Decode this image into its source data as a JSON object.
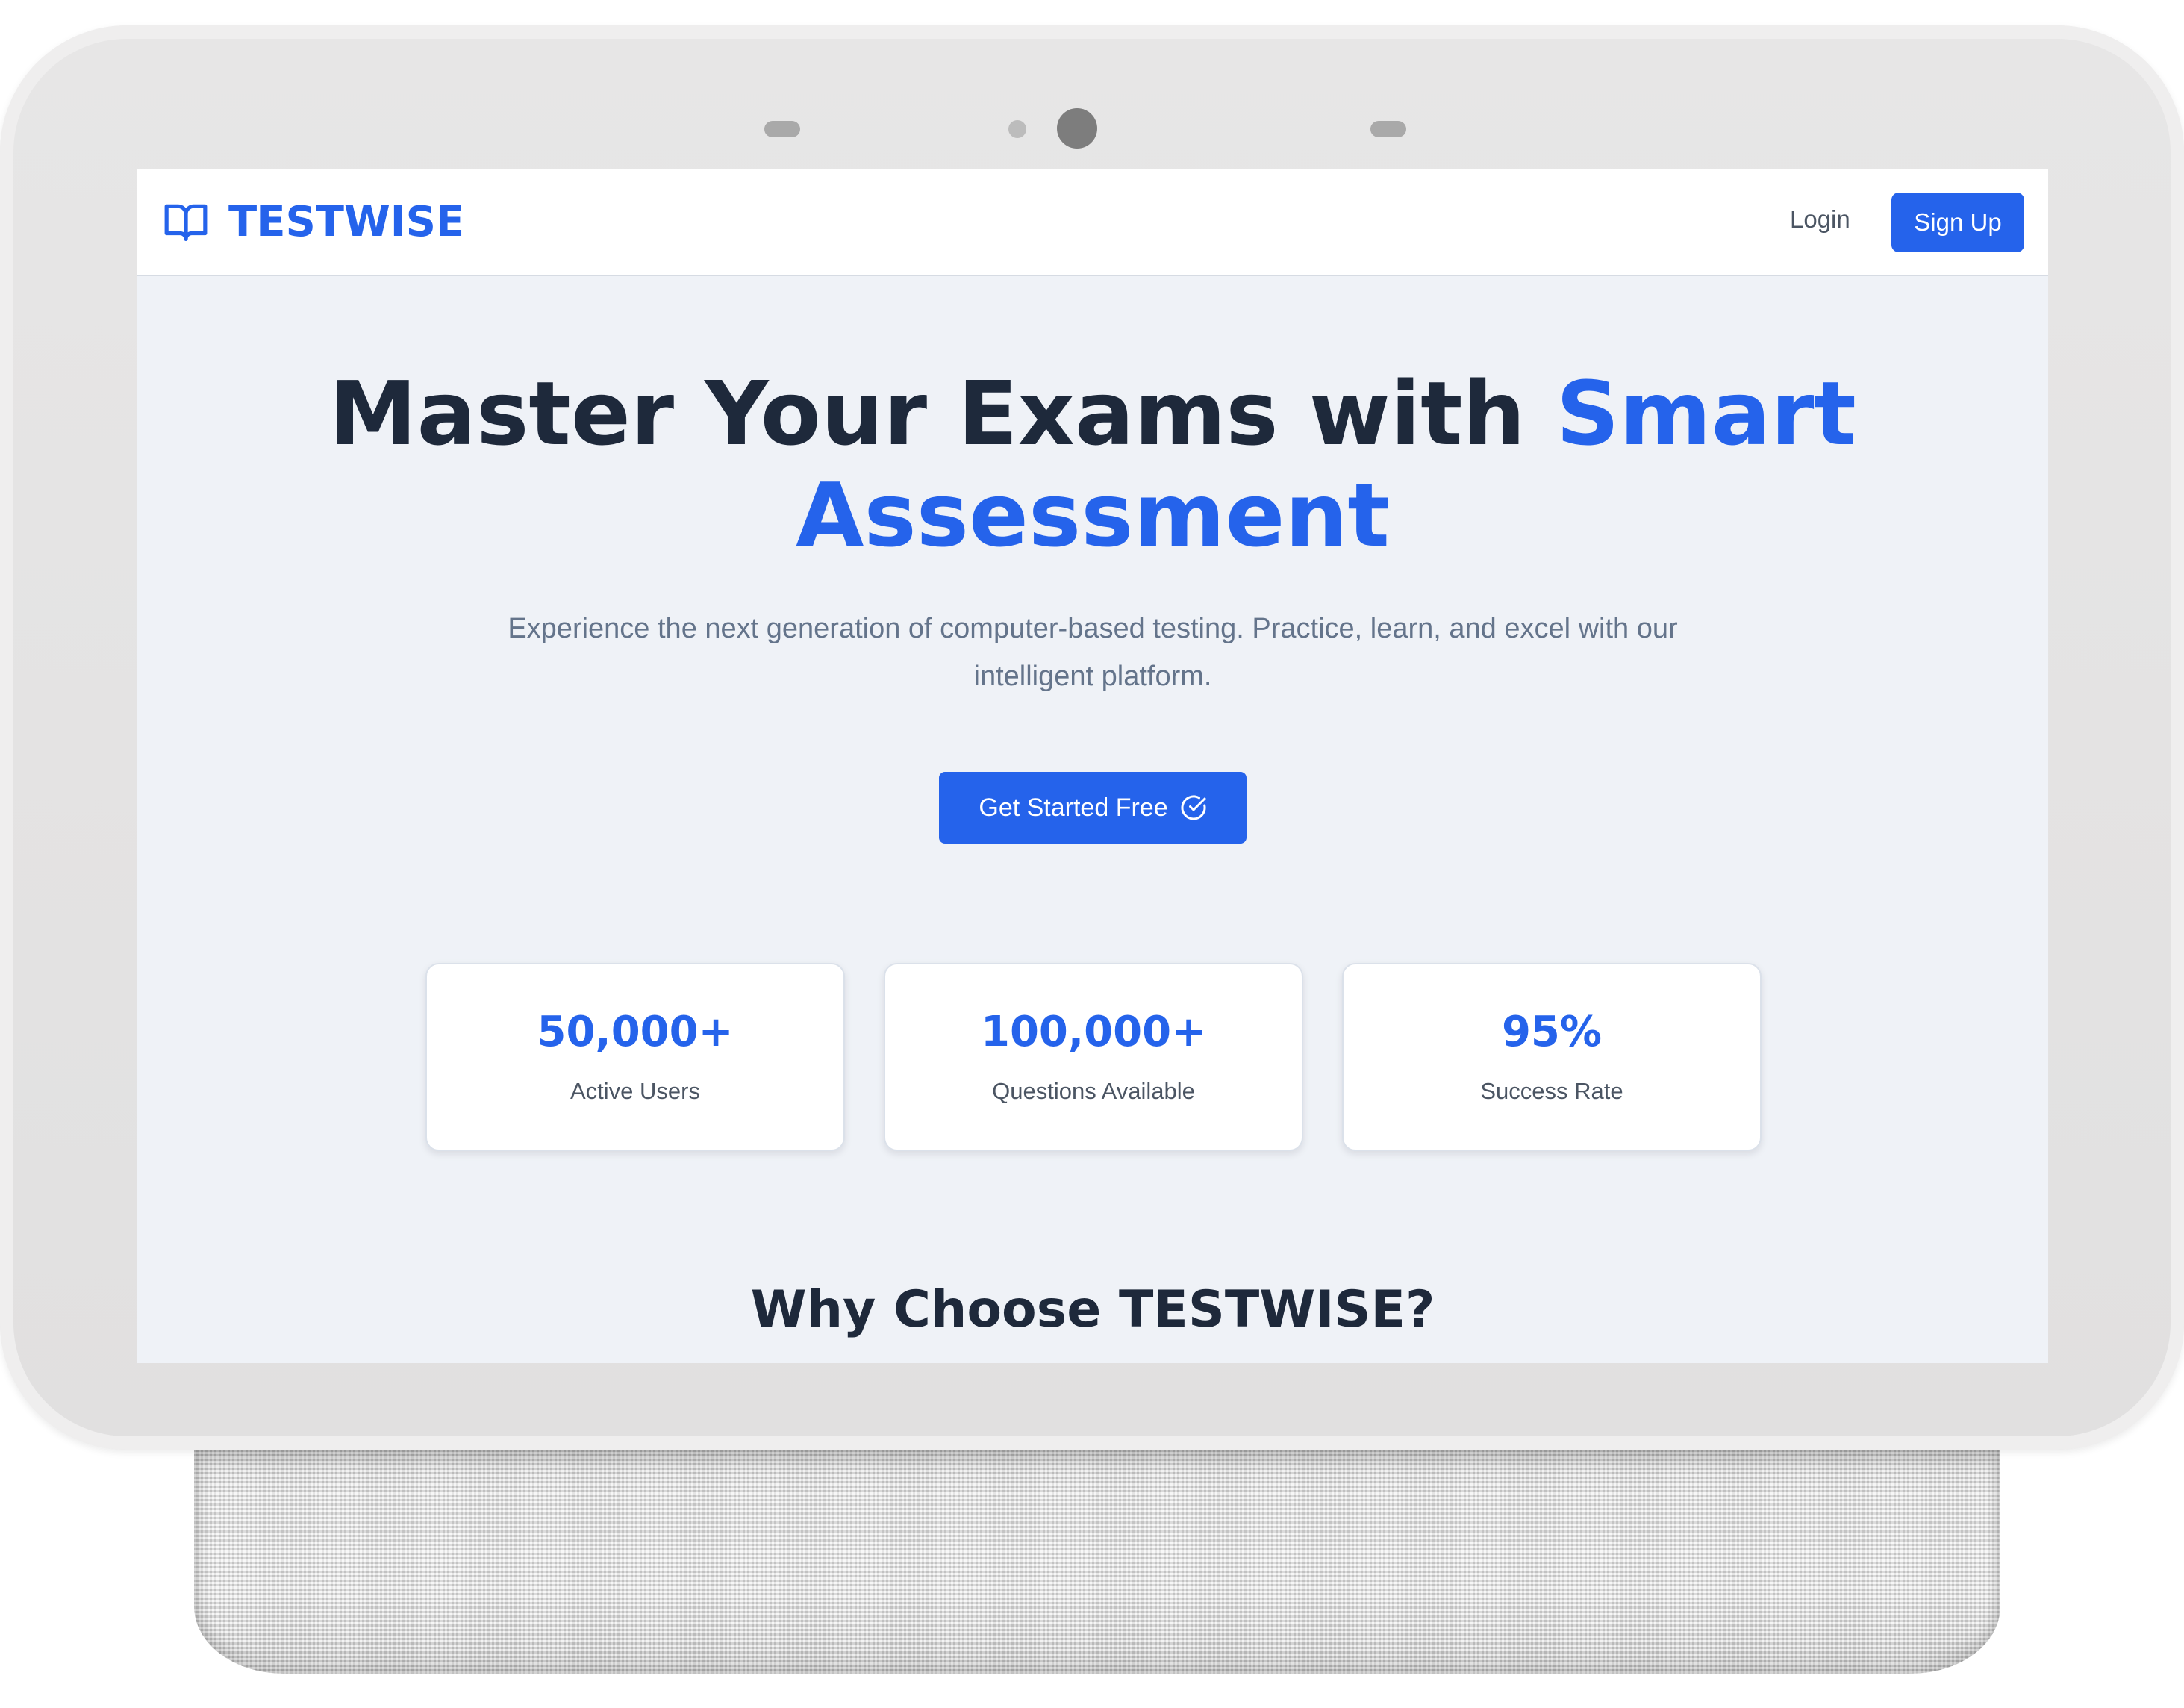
{
  "header": {
    "brand": "TESTWISE",
    "login_label": "Login",
    "signup_label": "Sign Up"
  },
  "hero": {
    "title_main": "Master Your Exams with ",
    "title_accent": "Smart Assessment",
    "subtitle": "Experience the next generation of computer-based testing. Practice, learn, and excel with our intelligent platform.",
    "cta_label": "Get Started Free"
  },
  "stats": [
    {
      "value": "50,000+",
      "label": "Active Users"
    },
    {
      "value": "100,000+",
      "label": "Questions Available"
    },
    {
      "value": "95%",
      "label": "Success Rate"
    }
  ],
  "section": {
    "why_title": "Why Choose TESTWISE?"
  },
  "icons": {
    "brand": "book-open-icon",
    "cta": "check-circle-icon"
  },
  "colors": {
    "accent": "#2563eb",
    "heading": "#1e293b",
    "muted": "#64748b",
    "background": "#eff2f7"
  }
}
